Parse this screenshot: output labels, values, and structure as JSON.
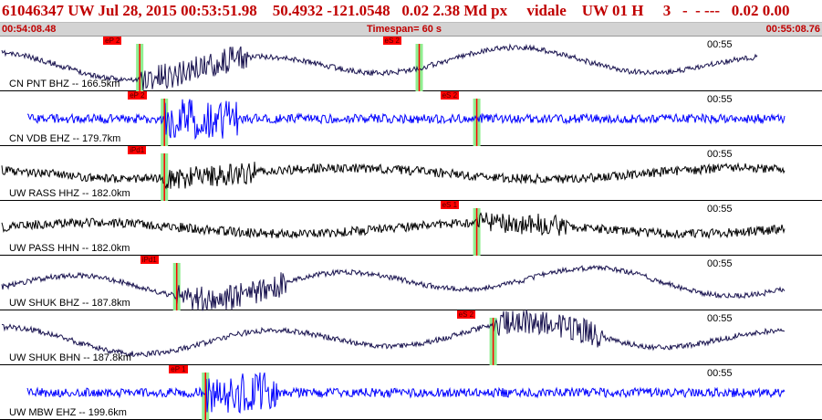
{
  "header": {
    "title": "61046347 UW Jul 28, 2015 00:53:51.98    50.4932 -121.0548   0.02 2.38 Md px     vidale    UW 01 H     3   -  - ---   0.02 0.00",
    "start_time": "00:54:08.48",
    "timespan": "Timespan=  60 s",
    "end_time": "00:55:08.76"
  },
  "colors": {
    "header_text": "#c00000",
    "dark_trace": "#1a1450",
    "blue_trace": "#0000ff",
    "black_trace": "#000000",
    "pick": "#ff0000",
    "window": "#90ee90"
  },
  "traces": [
    {
      "label": "CN PNT BHZ -- 166.5km",
      "time_mark": "00:55",
      "color": "#1a1450",
      "style": "long",
      "seed": 11,
      "picks": [
        {
          "label": "eP 2",
          "at": 0.17
        },
        {
          "label": "eS 2",
          "at": 0.51
        }
      ]
    },
    {
      "label": "CN VDB EHZ -- 179.7km",
      "time_mark": "00:55",
      "color": "#0000ff",
      "style": "noise",
      "seed": 23,
      "picks": [
        {
          "label": "eP 2",
          "at": 0.2
        },
        {
          "label": "eS 2",
          "at": 0.58
        }
      ]
    },
    {
      "label": "UW RASS HHZ -- 182.0km",
      "time_mark": "00:55",
      "color": "#000000",
      "style": "mid",
      "seed": 37,
      "picks": [
        {
          "label": "iPd1",
          "at": 0.2
        }
      ]
    },
    {
      "label": "UW PASS HHN -- 182.0km",
      "time_mark": "00:55",
      "color": "#000000",
      "style": "mid",
      "seed": 41,
      "picks": [
        {
          "label": "eS 1",
          "at": 0.58
        }
      ]
    },
    {
      "label": "UW SHUK BHZ -- 187.8km",
      "time_mark": "00:55",
      "color": "#1a1450",
      "style": "long",
      "seed": 53,
      "picks": [
        {
          "label": "iPd1",
          "at": 0.215
        }
      ]
    },
    {
      "label": "UW SHUK BHN -- 187.8km",
      "time_mark": "00:55",
      "color": "#1a1450",
      "style": "long",
      "seed": 61,
      "picks": [
        {
          "label": "eS 2",
          "at": 0.6
        }
      ]
    },
    {
      "label": "UW MBW EHZ -- 199.6km",
      "time_mark": "00:55",
      "color": "#0000ff",
      "style": "noise",
      "seed": 79,
      "picks": [
        {
          "label": "eP 1",
          "at": 0.25
        }
      ]
    }
  ]
}
